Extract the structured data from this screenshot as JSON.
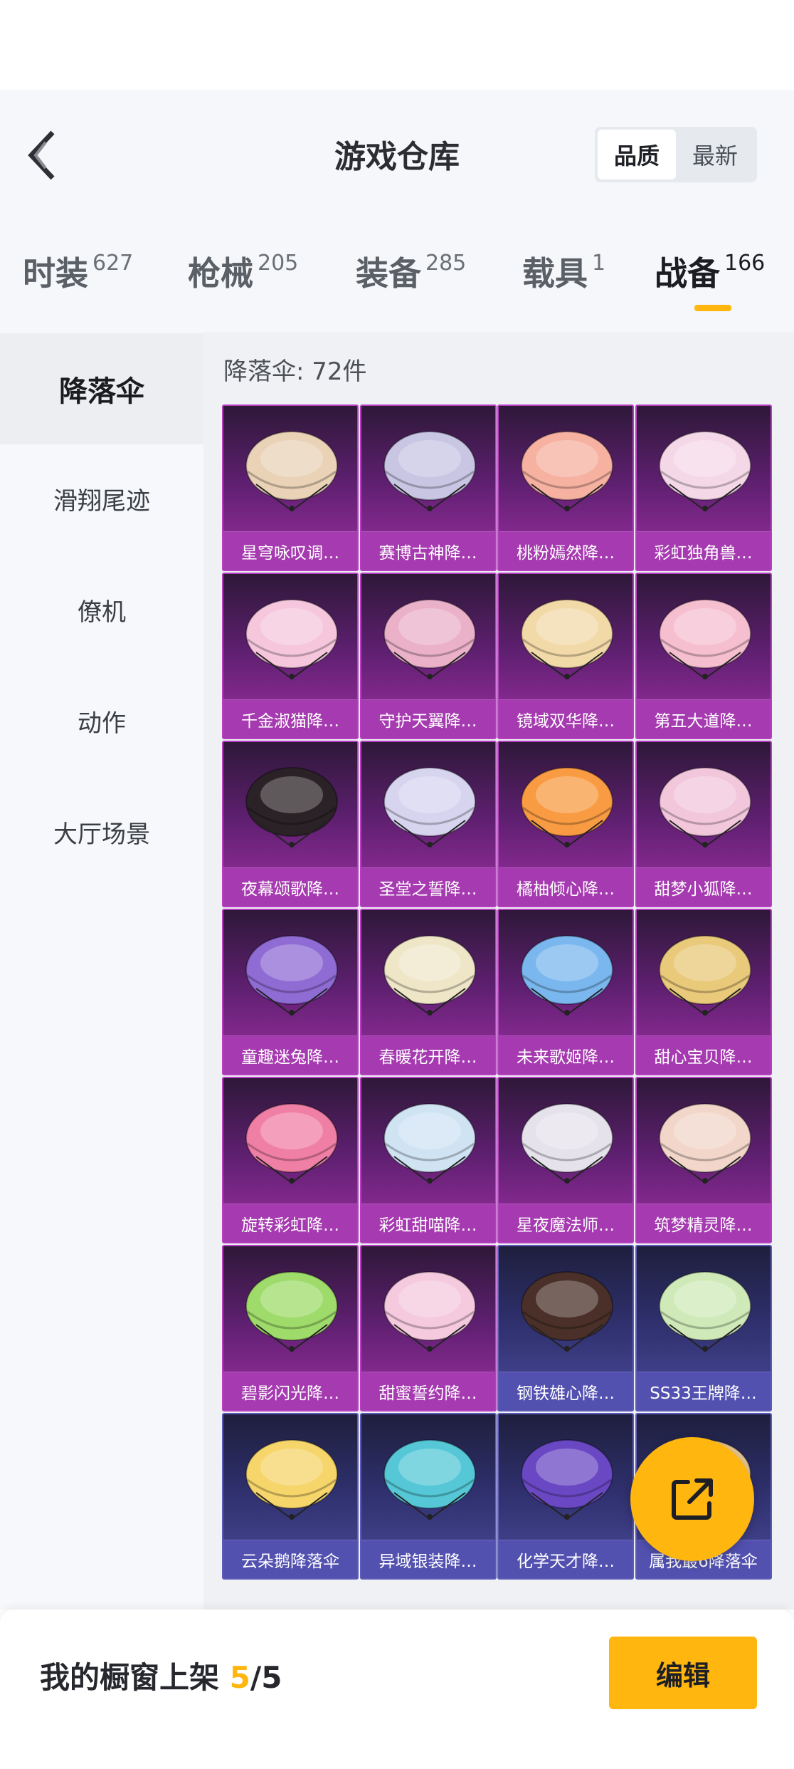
{
  "header": {
    "title": "游戏仓库",
    "sort": [
      "品质",
      "最新"
    ]
  },
  "tabs": [
    {
      "label": "时装",
      "count": "627"
    },
    {
      "label": "枪械",
      "count": "205"
    },
    {
      "label": "装备",
      "count": "285"
    },
    {
      "label": "载具",
      "count": "1"
    },
    {
      "label": "战备",
      "count": "166"
    }
  ],
  "sidebar": {
    "items": [
      "降落伞",
      "滑翔尾迹",
      "僚机",
      "动作",
      "大厅场景"
    ]
  },
  "category_count": "降落伞: 72件",
  "items": [
    {
      "name": "星穹咏叹调…",
      "color": "purple",
      "canopy": "#e9d2b6"
    },
    {
      "name": "赛博古神降…",
      "color": "purple",
      "canopy": "#c9c6e4"
    },
    {
      "name": "桃粉嫣然降…",
      "color": "purple",
      "canopy": "#f6b1a1"
    },
    {
      "name": "彩虹独角兽…",
      "color": "purple",
      "canopy": "#f4d8e7"
    },
    {
      "name": "千金淑猫降…",
      "color": "purple",
      "canopy": "#f6c7dc"
    },
    {
      "name": "守护天翼降…",
      "color": "purple",
      "canopy": "#eab1c9"
    },
    {
      "name": "镜域双华降…",
      "color": "purple",
      "canopy": "#f2d9a8"
    },
    {
      "name": "第五大道降…",
      "color": "purple",
      "canopy": "#f6bfd0"
    },
    {
      "name": "夜幕颂歌降…",
      "color": "purple",
      "canopy": "#2a2226"
    },
    {
      "name": "圣堂之誓降…",
      "color": "purple",
      "canopy": "#d7d4ef"
    },
    {
      "name": "橘柚倾心降…",
      "color": "purple",
      "canopy": "#f99b42"
    },
    {
      "name": "甜梦小狐降…",
      "color": "purple",
      "canopy": "#f2c7dc"
    },
    {
      "name": "童趣迷兔降…",
      "color": "purple",
      "canopy": "#8f6bd4"
    },
    {
      "name": "春暖花开降…",
      "color": "purple",
      "canopy": "#efe6c8"
    },
    {
      "name": "未来歌姬降…",
      "color": "purple",
      "canopy": "#7ab7ee"
    },
    {
      "name": "甜心宝贝降…",
      "color": "purple",
      "canopy": "#e9c97a"
    },
    {
      "name": "旋转彩虹降…",
      "color": "purple",
      "canopy": "#f07fa5"
    },
    {
      "name": "彩虹甜喵降…",
      "color": "purple",
      "canopy": "#cfe3f3"
    },
    {
      "name": "星夜魔法师…",
      "color": "purple",
      "canopy": "#e6e2ec"
    },
    {
      "name": "筑梦精灵降…",
      "color": "purple",
      "canopy": "#f1d6c9"
    },
    {
      "name": "碧影闪光降…",
      "color": "purple",
      "canopy": "#9edb6a"
    },
    {
      "name": "甜蜜誓约降…",
      "color": "purple",
      "canopy": "#f5c9de"
    },
    {
      "name": "钢铁雄心降…",
      "color": "blue",
      "canopy": "#4a3028"
    },
    {
      "name": "SS33王牌降…",
      "color": "blue",
      "canopy": "#cfeab8"
    },
    {
      "name": "云朵鹅降落伞",
      "color": "blue",
      "canopy": "#f6d56a"
    },
    {
      "name": "异域银装降…",
      "color": "blue",
      "canopy": "#55c7d6"
    },
    {
      "name": "化学天才降…",
      "color": "blue",
      "canopy": "#6a48c4"
    },
    {
      "name": "属我最6降落伞",
      "color": "blue",
      "canopy": "#e7c690"
    }
  ],
  "showcase": {
    "label": "我的橱窗上架",
    "current": "5",
    "total": "/5"
  },
  "edit_label": "编辑",
  "icons": {
    "back": "chevron-left-icon",
    "share": "share-external-icon"
  },
  "colors": {
    "accent": "#ffb60f",
    "purple_rarity": "#a63ab0",
    "blue_rarity": "#5351b0"
  }
}
